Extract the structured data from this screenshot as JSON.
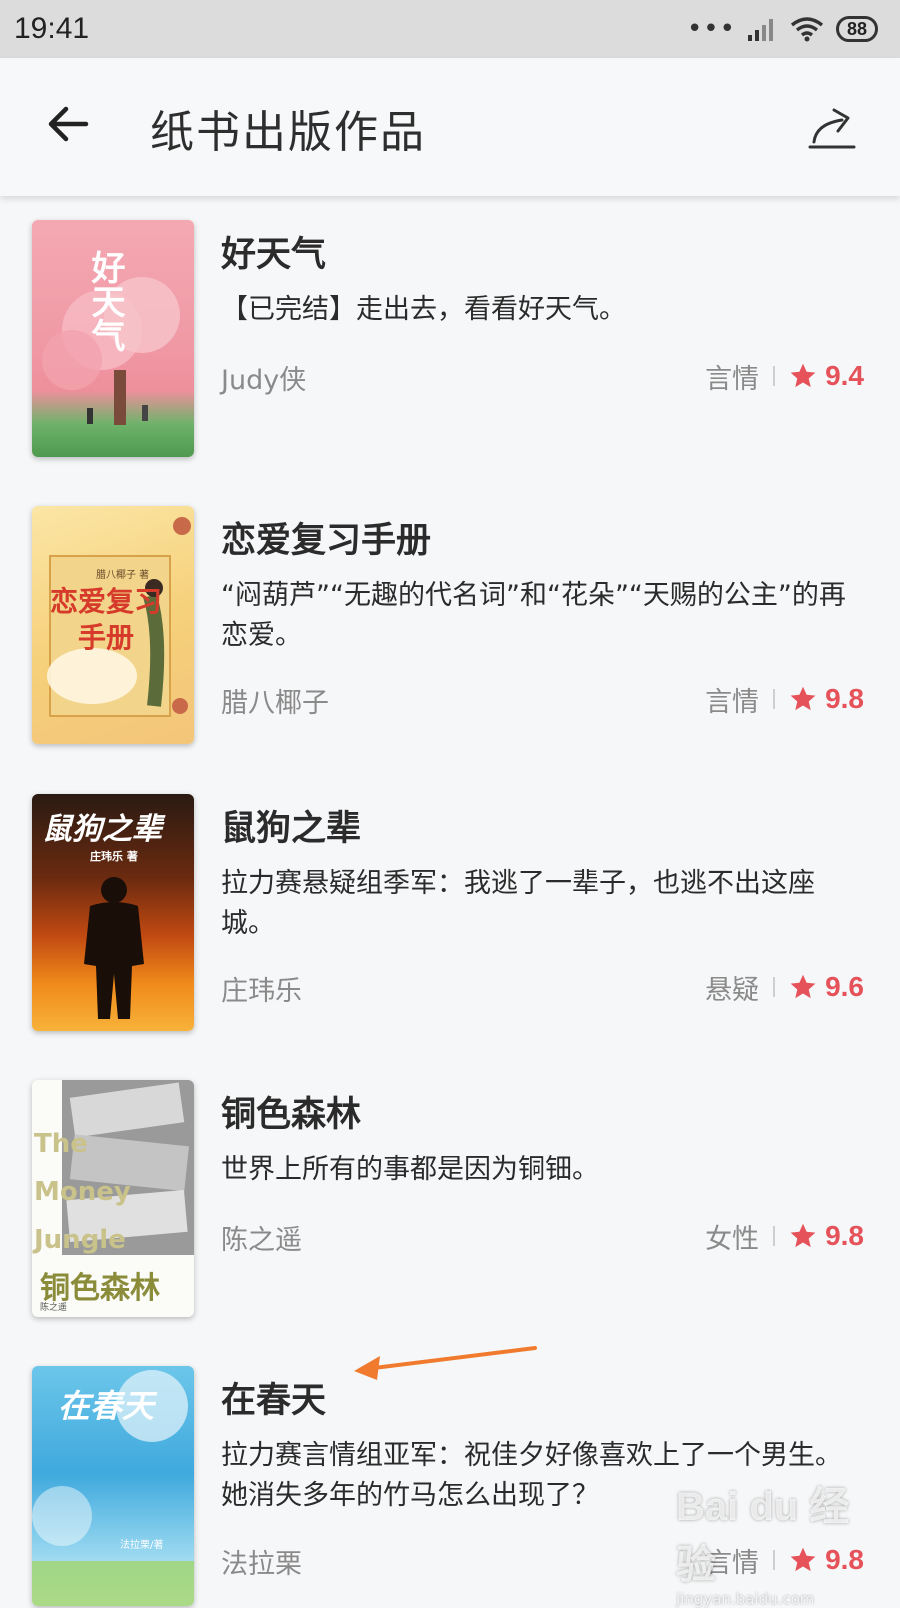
{
  "status_bar": {
    "time": "19:41",
    "battery": "88"
  },
  "header": {
    "title": "纸书出版作品"
  },
  "books": [
    {
      "title": "好天气",
      "desc": "【已完结】走出去，看看好天气。",
      "author": "Judy侠",
      "genre": "言情",
      "rating": "9.4",
      "cover_title": "好天气"
    },
    {
      "title": "恋爱复习手册",
      "desc": "“闷葫芦”“无趣的代名词”和“花朵”“天赐的公主”的再恋爱。",
      "author": "腊八椰子",
      "genre": "言情",
      "rating": "9.8",
      "cover_title": "恋爱复习手册",
      "cover_author": "腊八椰子 著"
    },
    {
      "title": "鼠狗之辈",
      "desc": "拉力赛悬疑组季军：我逃了一辈子，也逃不出这座城。",
      "author": "庄玮乐",
      "genre": "悬疑",
      "rating": "9.6",
      "cover_title": "鼠狗之辈",
      "cover_author": "庄玮乐 著"
    },
    {
      "title": "铜色森林",
      "desc": "世界上所有的事都是因为铜钿。",
      "author": "陈之遥",
      "genre": "女性",
      "rating": "9.8",
      "cover_title": "铜色森林",
      "cover_en": "The Money Jungle",
      "cover_author": "陈之遥"
    },
    {
      "title": "在春天",
      "desc": "拉力赛言情组亚军：祝佳夕好像喜欢上了一个男生。她消失多年的竹马怎么出现了？",
      "author": "法拉栗",
      "genre": "言情",
      "rating": "9.8",
      "cover_title": "在春天",
      "cover_author": "法拉栗/著"
    }
  ],
  "watermark": {
    "brand": "Bai du 经验",
    "url": "jingyan.baidu.com"
  },
  "colors": {
    "accent": "#e5525a",
    "annotation_arrow": "#f07b2e"
  }
}
